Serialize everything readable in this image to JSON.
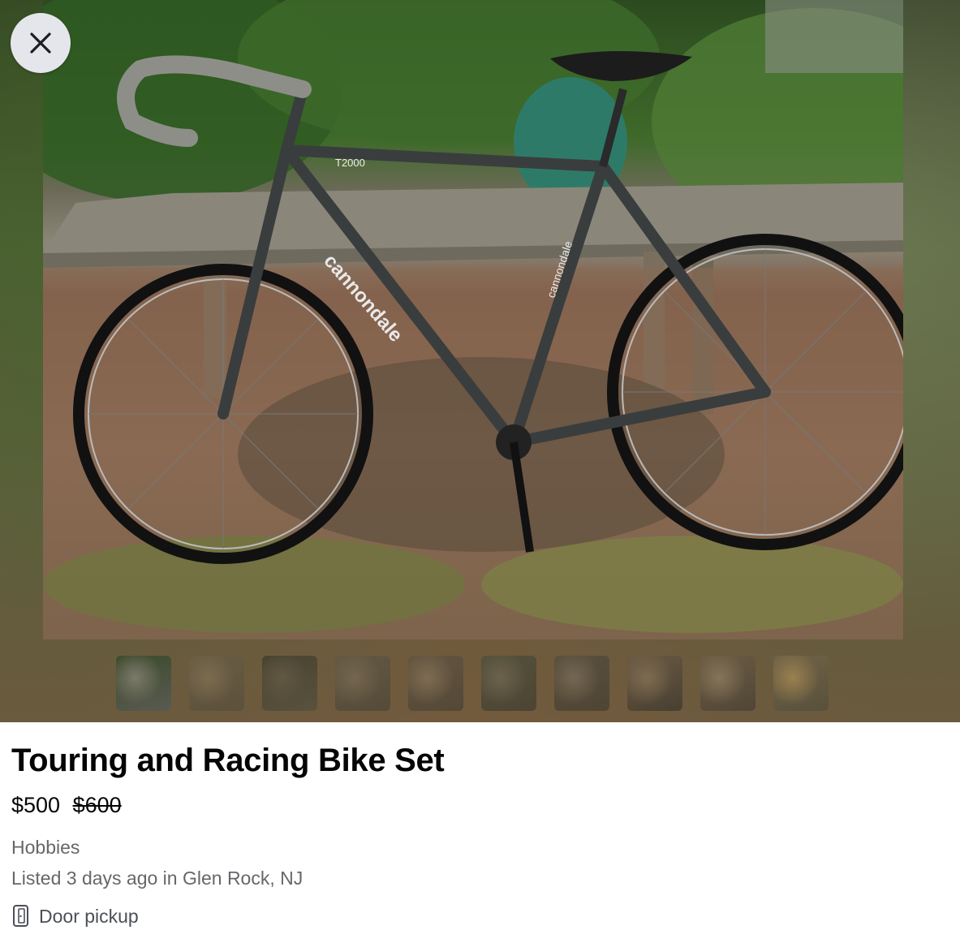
{
  "gallery": {
    "photo_alt": "Cannondale T2000 bike",
    "close_icon": "close-icon",
    "frame_brand": "cannondale",
    "frame_model": "T2000",
    "thumbnails": [
      {
        "label": "photo-1",
        "active": true
      },
      {
        "label": "photo-2",
        "active": false
      },
      {
        "label": "photo-3",
        "active": false
      },
      {
        "label": "photo-4",
        "active": false
      },
      {
        "label": "photo-5",
        "active": false
      },
      {
        "label": "photo-6",
        "active": false
      },
      {
        "label": "photo-7",
        "active": false
      },
      {
        "label": "photo-8",
        "active": false
      },
      {
        "label": "photo-9",
        "active": false
      },
      {
        "label": "photo-10",
        "active": false
      }
    ]
  },
  "listing": {
    "title": "Touring and Racing Bike Set",
    "price": "$500",
    "original_price": "$600",
    "category": "Hobbies",
    "listed": "Listed 3 days ago in Glen Rock, NJ",
    "pickup_icon": "door-icon",
    "pickup": "Door pickup"
  }
}
